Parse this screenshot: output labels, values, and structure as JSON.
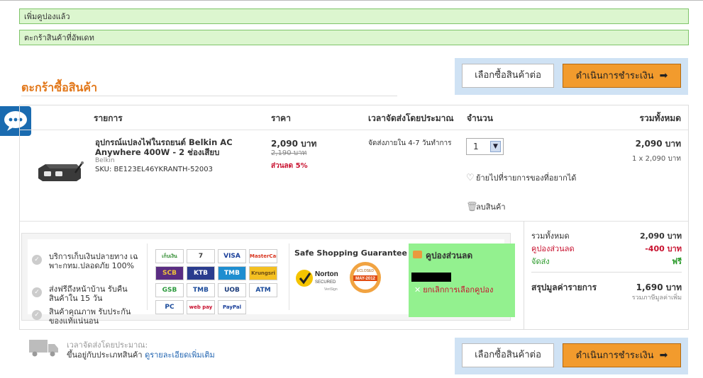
{
  "messages": [
    "เพิ่มคูปองแล้ว",
    "ตะกร้าสินค้าที่อัพเดท"
  ],
  "page_title": "ตะกร้าซื้อสินค้า",
  "buttons": {
    "continue_shopping": "เลือกซื้อสินค้าต่อ",
    "checkout": "ดำเนินการชำระเงิน"
  },
  "table_headers": {
    "item": "รายการ",
    "price": "ราคา",
    "delivery": "เวลาจัดส่งโดยประมาณ",
    "quantity": "จำนวน",
    "total": "รวมทั้งหมด"
  },
  "product": {
    "name": "อุปกรณ์แปลงไฟในรถยนต์ Belkin AC Anywhere 400W - 2 ช่องเสียบ",
    "brand": "Belkin",
    "sku": "SKU: BE123EL46YKRANTH-52003",
    "price": "2,090 บาท",
    "old_price": "2,190 บาท",
    "discount": "ส่วนลด 5%",
    "delivery": "จัดส่งภายใน 4-7 วันทำการ",
    "quantity": "1",
    "wishlist_label": "ย้ายไปที่รายการของที่อยากได้",
    "remove_label": "ลบสินค้า",
    "line_total": "2,090 บาท",
    "line_sub": "1 x 2,090 บาท"
  },
  "services": [
    "บริการเก็บเงินปลายทาง เฉพาะกทม.ปลอดภัย 100%",
    "ส่งฟรีถึงหน้าบ้าน รับคืนสินค้าใน 15 วัน",
    "สินค้าคุณภาพ รับประกันของแท้แน่นอน"
  ],
  "payment_methods": [
    {
      "label": "เก็บเงินปลายทาง",
      "bg": "#ffffff",
      "fg": "#2d8a2d"
    },
    {
      "label": "7",
      "bg": "#ffffff",
      "fg": "#3a3a3a"
    },
    {
      "label": "VISA",
      "bg": "#ffffff",
      "fg": "#1a3f9a"
    },
    {
      "label": "MasterCard",
      "bg": "#ffffff",
      "fg": "#d8341e"
    },
    {
      "label": "SCB",
      "bg": "#5a2d82",
      "fg": "#f0c43a"
    },
    {
      "label": "KTB",
      "bg": "#2a3c8e",
      "fg": "#ffffff"
    },
    {
      "label": "TMB",
      "bg": "#1f8ed0",
      "fg": "#ffffff"
    },
    {
      "label": "Krungsri",
      "bg": "#f4c021",
      "fg": "#6b4a13"
    },
    {
      "label": "GSB",
      "bg": "#ffffff",
      "fg": "#2c9a3d"
    },
    {
      "label": "TMB",
      "bg": "#ffffff",
      "fg": "#1a4a9a"
    },
    {
      "label": "UOB",
      "bg": "#ffffff",
      "fg": "#1a3a7a"
    },
    {
      "label": "ATM",
      "bg": "#ffffff",
      "fg": "#1a4a9a"
    },
    {
      "label": "PC",
      "bg": "#ffffff",
      "fg": "#1a4a9a"
    },
    {
      "label": "web pay",
      "bg": "#ffffff",
      "fg": "#c8102e"
    },
    {
      "label": "PayPal",
      "bg": "#ffffff",
      "fg": "#1a3f9a"
    }
  ],
  "safe_title": "Safe Shopping Guarantee",
  "norton": {
    "brand": "Norton",
    "sub": "SECURED",
    "by": "VeriSign"
  },
  "seal": {
    "top": "ECLOSED",
    "date": "MAY-2012"
  },
  "coupon": {
    "title": "คูปองส่วนลด",
    "cancel_label": "ยกเลิกการเลือกคูปอง"
  },
  "summary": {
    "subtotal_label": "รวมทั้งหมด",
    "subtotal_value": "2,090 บาท",
    "coupon_label": "คูปองส่วนลด",
    "coupon_value": "-400 บาท",
    "shipping_label": "จัดส่ง",
    "shipping_value": "ฟรี",
    "total_label": "สรุปมูลค่ารายการ",
    "total_value": "1,690 บาท",
    "vat_note": "รวมภาษีมูลค่าเพิ่ม"
  },
  "eta": {
    "label": "เวลาจัดส่งโดยประมาณ:",
    "text": "ขึ้นอยู่กับประเภทสินค้า",
    "link": "ดูรายละเอียดเพิ่มเติม"
  },
  "colors": {
    "accent_orange": "#f29b2d",
    "title_orange": "#e2781b",
    "button_box": "#cfe2f4",
    "coupon_green": "#93f18f",
    "message_green": "#dcf6cf",
    "discount_red": "#c8102e",
    "free_green": "#2a9a2a"
  }
}
